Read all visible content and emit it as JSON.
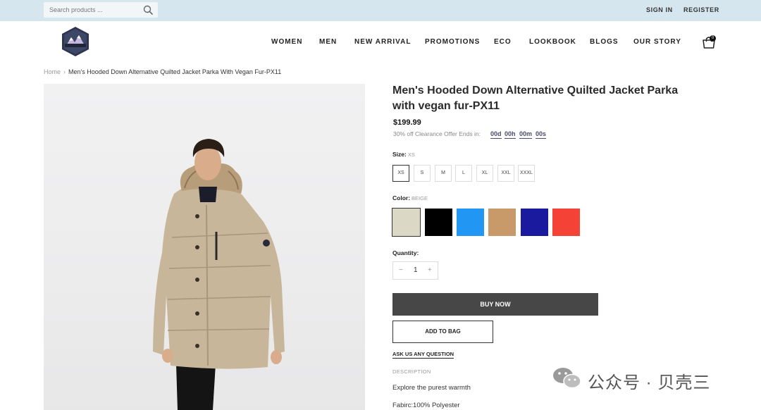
{
  "topbar": {
    "search_placeholder": "Search products ...",
    "sign_in": "SIGN IN",
    "register": "REGISTER"
  },
  "nav": [
    "WOMEN",
    "MEN",
    "NEW ARRIVAL",
    "PROMOTIONS",
    "ECO",
    "LOOKBOOK",
    "BLOGS",
    "OUR STORY"
  ],
  "cart": {
    "count": "0"
  },
  "breadcrumb": {
    "home": "Home",
    "current": "Men's Hooded Down Alternative Quilted Jacket Parka With Vegan Fur-PX11"
  },
  "product": {
    "title": "Men's Hooded Down Alternative Quilted Jacket Parka with vegan fur-PX11",
    "price": "$199.99",
    "offer_text": "30% off Clearance Offer Ends in:",
    "countdown": [
      "00d",
      "00h",
      "00m",
      "00s"
    ],
    "size_label": "Size:",
    "size_value": "XS",
    "sizes": [
      "XS",
      "S",
      "M",
      "L",
      "XL",
      "XXL",
      "XXXL"
    ],
    "color_label": "Color:",
    "color_value": "BEIGE",
    "colors": [
      "#dcd8c6",
      "#000000",
      "#2196f3",
      "#c89a6a",
      "#1a1a9e",
      "#f44336"
    ],
    "quantity_label": "Quantity:",
    "quantity": "1",
    "buy_now": "BUY NOW",
    "add_to_bag": "ADD TO BAG",
    "ask": "ASK US ANY QUESTION",
    "description_heading": "DESCRIPTION",
    "description_line1": "Explore the purest warmth",
    "description_line2": "Fabirc:100% Polyester"
  },
  "watermark": {
    "text": "公众号 · 贝壳三"
  }
}
